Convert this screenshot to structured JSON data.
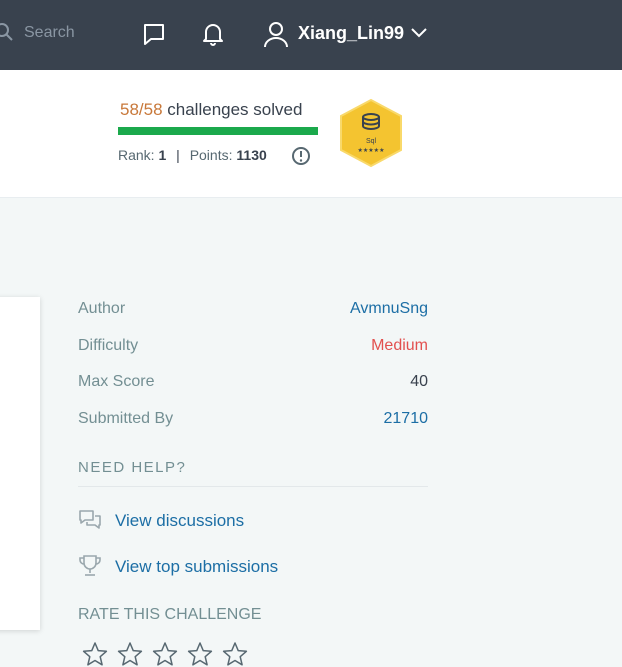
{
  "nav": {
    "search_placeholder": "Search",
    "username": "Xiang_Lin99"
  },
  "progress": {
    "solved": "58/58",
    "suffix": " challenges solved",
    "fraction": 1.0,
    "rank_label": "Rank:",
    "rank_value": "1",
    "points_label": "Points:",
    "points_value": "1130",
    "badge_name": "Sql",
    "badge_stars": "★★★★★"
  },
  "details": {
    "author_label": "Author",
    "author_value": "AvmnuSng",
    "difficulty_label": "Difficulty",
    "difficulty_value": "Medium",
    "max_score_label": "Max Score",
    "max_score_value": "40",
    "submitted_label": "Submitted By",
    "submitted_value": "21710"
  },
  "help": {
    "title": "NEED HELP?",
    "discussions": "View discussions",
    "top_submissions": "View top submissions"
  },
  "rating": {
    "title": "RATE THIS CHALLENGE",
    "stars_total": 5,
    "stars_filled": 0
  },
  "colors": {
    "nav_bg": "#39424e",
    "progress_green": "#1ba94c",
    "solved_orange": "#c8783a",
    "link_blue": "#1c6ea5",
    "medium_red": "#e2504f",
    "badge_gold": "#f4c430"
  }
}
